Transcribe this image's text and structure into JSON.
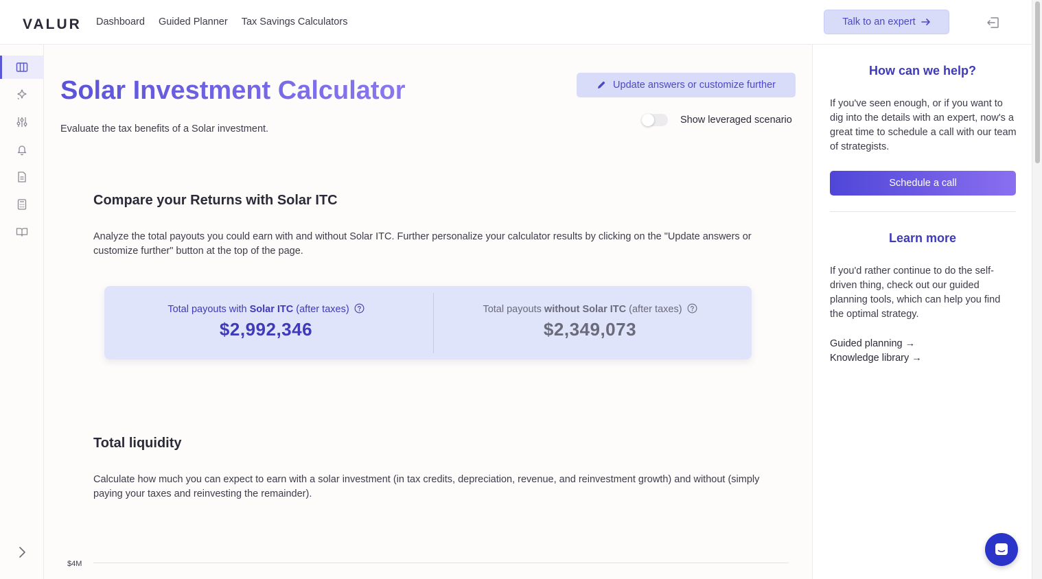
{
  "header": {
    "logo": "VALUR",
    "nav": [
      "Dashboard",
      "Guided Planner",
      "Tax Savings Calculators"
    ],
    "talk_button": "Talk to an expert"
  },
  "rail": {
    "icons": [
      "columns-icon",
      "sparkle-icon",
      "sliders-icon",
      "bell-icon",
      "document-icon",
      "calculator-icon",
      "book-icon"
    ]
  },
  "main": {
    "title": "Solar Investment Calculator",
    "subtitle": "Evaluate the tax benefits of a Solar investment.",
    "update_button": "Update answers or customize further",
    "toggle_label": "Show leveraged scenario",
    "compare": {
      "heading": "Compare your Returns with Solar ITC",
      "text": "Analyze the total payouts you could earn with and without Solar ITC. Further personalize your calculator results by clicking on the \"Update answers or customize further\" button at the top of the page."
    },
    "payouts": {
      "with_prefix": "Total payouts with ",
      "with_bold": "Solar ITC",
      "with_suffix": " (after taxes)",
      "with_value": "$2,992,346",
      "without_prefix": "Total payouts ",
      "without_bold": "without Solar ITC",
      "without_suffix": " (after taxes)",
      "without_value": "$2,349,073"
    },
    "liquidity": {
      "heading": "Total liquidity",
      "text": "Calculate how much you can expect to earn with a solar investment (in tax credits, depreciation, revenue, and reinvestment growth) and without (simply paying your taxes and reinvesting the remainder)."
    },
    "axis_label": "$4M"
  },
  "panel": {
    "help_heading": "How can we help?",
    "help_text": "If you've seen enough, or if you want to dig into the details with an expert, now's a great time to schedule a call with our team of strategists.",
    "schedule_button": "Schedule a call",
    "learn_heading": "Learn more",
    "learn_text": "If you'd rather continue to do the self-driven thing, check out our guided planning tools, which can help you find the optimal strategy.",
    "link_guided": "Guided planning →",
    "link_library": "Knowledge library →"
  },
  "colors": {
    "accent": "#4a48c8",
    "accent_light": "#d9dcf8",
    "card_bg": "#dfe4fa"
  }
}
